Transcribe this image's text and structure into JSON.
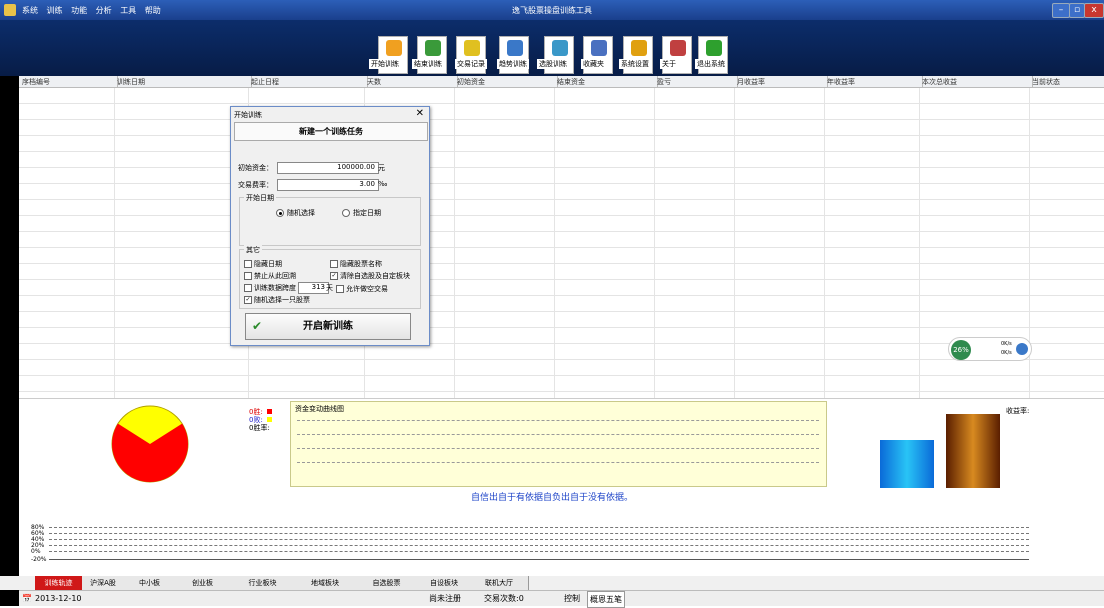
{
  "titlebar": {
    "menu": [
      "系统",
      "训练",
      "功能",
      "分析",
      "工具",
      "帮助"
    ],
    "title": "逸飞股票操盘训练工具"
  },
  "toolbar": {
    "buttons": [
      {
        "label": "开始训练",
        "icon": "upload-arrow-icon",
        "color": "#f0a020"
      },
      {
        "label": "结束训练",
        "icon": "image-icon",
        "color": "#3a9a3a"
      },
      {
        "label": "交易记录",
        "icon": "edit-icon",
        "color": "#e0c020"
      },
      {
        "label": "趋势训练",
        "icon": "globe-icon",
        "color": "#3a78c8"
      },
      {
        "label": "选股训练",
        "icon": "globe-icon",
        "color": "#3a98c8"
      },
      {
        "label": "收藏夹",
        "icon": "picture-icon",
        "color": "#4a70c0"
      },
      {
        "label": "系统设置",
        "icon": "gear-icon",
        "color": "#e0a010"
      },
      {
        "label": "关于",
        "icon": "people-icon",
        "color": "#c04040"
      },
      {
        "label": "退出系统",
        "icon": "exit-arrow-icon",
        "color": "#2ea02e"
      }
    ]
  },
  "table": {
    "headers": [
      "序档编号",
      "训练日期",
      "起止日程",
      "天数",
      "初始资金",
      "结束资金",
      "盈亏",
      "月收益率",
      "年收益率",
      "本次总收益",
      "当前状态"
    ]
  },
  "dialog": {
    "title": "开始训练",
    "close": "✕",
    "new_task": "新建一个训练任务",
    "initial_fund_label": "初始资金：",
    "initial_fund_value": "100000.00",
    "initial_fund_unit": "元",
    "fee_label": "交易费率：",
    "fee_value": "3.00",
    "fee_unit": "‰",
    "start_date_group": "开始日期",
    "radio_random": "随机选择",
    "radio_specify": "指定日期",
    "other_group": "其它",
    "cb_hide_date": "隐藏日期",
    "cb_hide_name": "隐藏股票名称",
    "cb_no_lookback": "禁止从此回溯",
    "cb_clear_custom": "清除自选股及自定板块",
    "cb_span_label": "训练数据跨度",
    "cb_span_value": "313",
    "cb_span_unit": "天",
    "cb_allow_short": "允许做空交易",
    "cb_random_one": "随机选择一只股票",
    "start_button": "开启新训练",
    "start_check": "✔"
  },
  "pie": {
    "legend_win": "0胜:",
    "legend_loss": "0败:",
    "legend_rate": "0胜率:",
    "win_color": "#ff0000",
    "loss_color": "#ffff00",
    "win_fraction": 0.68
  },
  "curve": {
    "title": "资金变动曲线图"
  },
  "bars": {
    "label": "收益率:",
    "bar1_color": "#19a8e8",
    "bar2_color": "#8a3a0a"
  },
  "widget": {
    "percent": "26%",
    "line1": "0K/s",
    "line2": "0K/s"
  },
  "motto": "自信出自于有依据自负出自于没有依据。",
  "lowchart": {
    "ticks": [
      "80%",
      "60%",
      "40%",
      "20%",
      "0%",
      "-20%"
    ]
  },
  "tabs": [
    "训练轨迹",
    "沪深A股",
    "中小板",
    "创业板",
    "行业板块",
    "地域板块",
    "自选股票",
    "自设板块",
    "联机大厅"
  ],
  "statusbar": {
    "date": "2013-12-10",
    "registered": "尚未注册",
    "trades": "交易次数:0",
    "control": "控制",
    "ticker": "概恩五笔"
  }
}
